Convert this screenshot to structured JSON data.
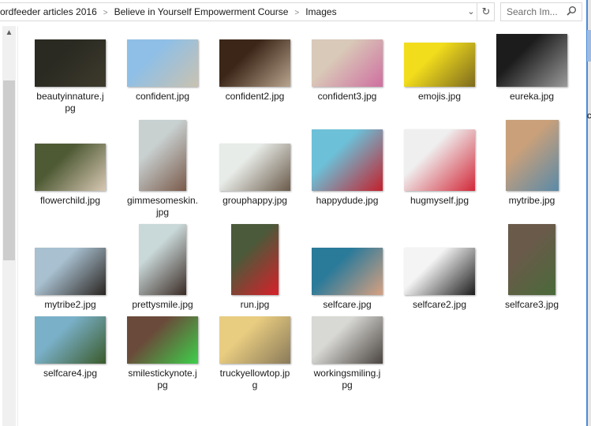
{
  "window": {
    "breadcrumb": [
      "ordfeeder articles 2016",
      "Believe in Yourself Empowerment Course",
      "Images"
    ],
    "search_placeholder": "Search Im...",
    "right_pane_char": "c"
  },
  "icons": {
    "dropdown": "⌄",
    "refresh": "↻",
    "scroll_up": "▲"
  },
  "files": [
    {
      "name": "beautyinnature.jpg",
      "label_lines": [
        "beautyinnature.j",
        "pg"
      ],
      "colors": [
        "#2a2a22",
        "#3e3a2c"
      ]
    },
    {
      "name": "confident.jpg",
      "label_lines": [
        "confident.jpg"
      ],
      "colors": [
        "#8fbfe6",
        "#c9c2b0"
      ]
    },
    {
      "name": "confident2.jpg",
      "label_lines": [
        "confident2.jpg"
      ],
      "colors": [
        "#3b2618",
        "#b9a48e"
      ]
    },
    {
      "name": "confident3.jpg",
      "label_lines": [
        "confident3.jpg"
      ],
      "colors": [
        "#d9c9b8",
        "#cf6fa0"
      ]
    },
    {
      "name": "emojis.jpg",
      "label_lines": [
        "emojis.jpg"
      ],
      "colors": [
        "#f2dd1c",
        "#7d6a1e"
      ]
    },
    {
      "name": "eureka.jpg",
      "label_lines": [
        "eureka.jpg"
      ],
      "colors": [
        "#1c1c1c",
        "#9a9a9a"
      ]
    },
    {
      "name": "flowerchild.jpg",
      "label_lines": [
        "flowerchild.jpg"
      ],
      "colors": [
        "#4e5a34",
        "#d8c8b4"
      ]
    },
    {
      "name": "gimmesomeskin.jpg",
      "label_lines": [
        "gimmesomeskin.",
        "jpg"
      ],
      "colors": [
        "#c8d0d0",
        "#7a5a4a"
      ]
    },
    {
      "name": "grouphappy.jpg",
      "label_lines": [
        "grouphappy.jpg"
      ],
      "colors": [
        "#e8ece8",
        "#6a5a4a"
      ]
    },
    {
      "name": "happydude.jpg",
      "label_lines": [
        "happydude.jpg"
      ],
      "colors": [
        "#6cc0d8",
        "#c4202c"
      ]
    },
    {
      "name": "hugmyself.jpg",
      "label_lines": [
        "hugmyself.jpg"
      ],
      "colors": [
        "#efefef",
        "#d22838"
      ]
    },
    {
      "name": "mytribe.jpg",
      "label_lines": [
        "mytribe.jpg"
      ],
      "colors": [
        "#c9a07a",
        "#5a8aa8"
      ]
    },
    {
      "name": "mytribe2.jpg",
      "label_lines": [
        "mytribe2.jpg"
      ],
      "colors": [
        "#a8c0d0",
        "#2a2420"
      ]
    },
    {
      "name": "prettysmile.jpg",
      "label_lines": [
        "prettysmile.jpg"
      ],
      "colors": [
        "#c9d8d8",
        "#3a2a24"
      ]
    },
    {
      "name": "run.jpg",
      "label_lines": [
        "run.jpg"
      ],
      "colors": [
        "#4a5a3a",
        "#d8202a"
      ]
    },
    {
      "name": "selfcare.jpg",
      "label_lines": [
        "selfcare.jpg"
      ],
      "colors": [
        "#2a7a9a",
        "#d8a080"
      ]
    },
    {
      "name": "selfcare2.jpg",
      "label_lines": [
        "selfcare2.jpg"
      ],
      "colors": [
        "#f4f4f4",
        "#1c1c1c"
      ]
    },
    {
      "name": "selfcare3.jpg",
      "label_lines": [
        "selfcare3.jpg"
      ],
      "colors": [
        "#6a5a4a",
        "#4a6a3a"
      ]
    },
    {
      "name": "selfcare4.jpg",
      "label_lines": [
        "selfcare4.jpg"
      ],
      "colors": [
        "#7ab0c8",
        "#3a5a2a"
      ]
    },
    {
      "name": "smilestickynote.jpg",
      "label_lines": [
        "smilestickynote.j",
        "pg"
      ],
      "colors": [
        "#6a4a3a",
        "#3ed04a"
      ]
    },
    {
      "name": "truckyellowtop.jpg",
      "label_lines": [
        "truckyellowtop.jp",
        "g"
      ],
      "colors": [
        "#e8cc80",
        "#8a7a5a"
      ]
    },
    {
      "name": "workingsmiling.jpg",
      "label_lines": [
        "workingsmiling.j",
        "pg"
      ],
      "colors": [
        "#d8d8d4",
        "#4a4440"
      ]
    }
  ]
}
